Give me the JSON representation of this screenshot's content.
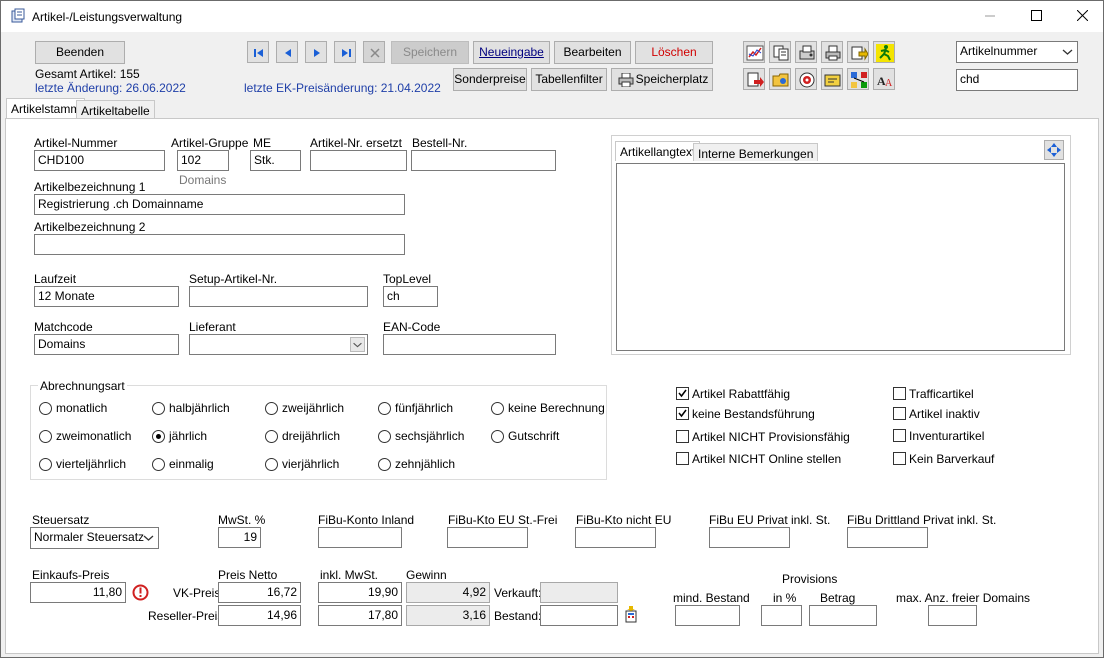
{
  "window": {
    "title": "Artikel-/Leistungsverwaltung"
  },
  "toolbar": {
    "beenden": "Beenden",
    "gesamt_artikel": "Gesamt Artikel: 155",
    "letzte_aenderung": "letzte Änderung: 26.06.2022",
    "letzte_ek": "letzte EK-Preisänderung: 21.04.2022",
    "speichern": "Speichern",
    "neueingabe": "Neueingabe",
    "bearbeiten": "Bearbeiten",
    "loeschen": "Löschen",
    "sonderpreise": "Sonderpreise",
    "tabellenfilter": "Tabellenfilter",
    "speicherplatz": "Speicherplatz",
    "search_field": "Artikelnummer",
    "search_value": "chd"
  },
  "tabs": {
    "artikelstamm": "Artikelstamm",
    "artikeltabelle": "Artikeltabelle"
  },
  "form": {
    "artikel_nummer_label": "Artikel-Nummer",
    "artikel_nummer": "CHD100",
    "artikel_gruppe_label": "Artikel-Gruppe",
    "artikel_gruppe": "102",
    "artikel_gruppe_name": "Domains",
    "me_label": "ME",
    "me": "Stk.",
    "ersetzt_label": "Artikel-Nr. ersetzt",
    "ersetzt": "",
    "bestell_label": "Bestell-Nr.",
    "bestell": "",
    "bez1_label": "Artikelbezeichnung 1",
    "bez1": "Registrierung .ch Domainname",
    "bez2_label": "Artikelbezeichnung 2",
    "bez2": "",
    "laufzeit_label": "Laufzeit",
    "laufzeit": "12 Monate",
    "setup_label": "Setup-Artikel-Nr.",
    "setup": "",
    "toplevel_label": "TopLevel",
    "toplevel": "ch",
    "matchcode_label": "Matchcode",
    "matchcode": "Domains",
    "lieferant_label": "Lieferant",
    "lieferant": "",
    "ean_label": "EAN-Code",
    "ean": ""
  },
  "texttabs": {
    "langtext": "Artikellangtext",
    "bemerkungen": "Interne Bemerkungen"
  },
  "abrechnung": {
    "label": "Abrechnungsart",
    "options": [
      "monatlich",
      "halbjährlich",
      "zweijährlich",
      "fünfjährlich",
      "keine Berechnung",
      "zweimonatlich",
      "jährlich",
      "dreijährlich",
      "sechsjährlich",
      "Gutschrift",
      "vierteljährlich",
      "einmalig",
      "vierjährlich",
      "zehnjählich"
    ],
    "selected": "jährlich"
  },
  "checks": {
    "rabatt": "Artikel Rabattfähig",
    "bestand": "keine Bestandsführung",
    "provision": "Artikel NICHT Provisionsfähig",
    "online": "Artikel NICHT Online stellen",
    "traffic": "Trafficartikel",
    "inaktiv": "Artikel inaktiv",
    "inventur": "Inventurartikel",
    "barverkauf": "Kein Barverkauf"
  },
  "steuer": {
    "steuersatz_label": "Steuersatz",
    "steuersatz": "Normaler Steuersatz",
    "mwst_label": "MwSt. %",
    "mwst": "19",
    "fibu_inland_label": "FiBu-Konto Inland",
    "fibu_eu_label": "FiBu-Kto EU St.-Frei",
    "fibu_nicht_eu_label": "FiBu-Kto nicht EU",
    "fibu_eu_privat_label": "FiBu EU Privat inkl. St.",
    "fibu_dritt_label": "FiBu Drittland Privat inkl. St."
  },
  "preise": {
    "ek_label": "Einkaufs-Preis",
    "ek": "11,80",
    "netto_label": "Preis Netto",
    "inkl_label": "inkl. MwSt.",
    "gewinn_label": "Gewinn",
    "vk_label": "VK-Preis:",
    "vk_netto": "16,72",
    "vk_inkl": "19,90",
    "vk_gewinn": "4,92",
    "reseller_label": "Reseller-Preis:",
    "res_netto": "14,96",
    "res_inkl": "17,80",
    "res_gewinn": "3,16",
    "verkauft_label": "Verkauft:",
    "bestand_label": "Bestand:",
    "mind_label": "mind. Bestand",
    "provisions_label": "Provisions",
    "inprozent_label": "in %",
    "betrag_label": "Betrag",
    "max_domains_label": "max. Anz. freier Domains"
  }
}
